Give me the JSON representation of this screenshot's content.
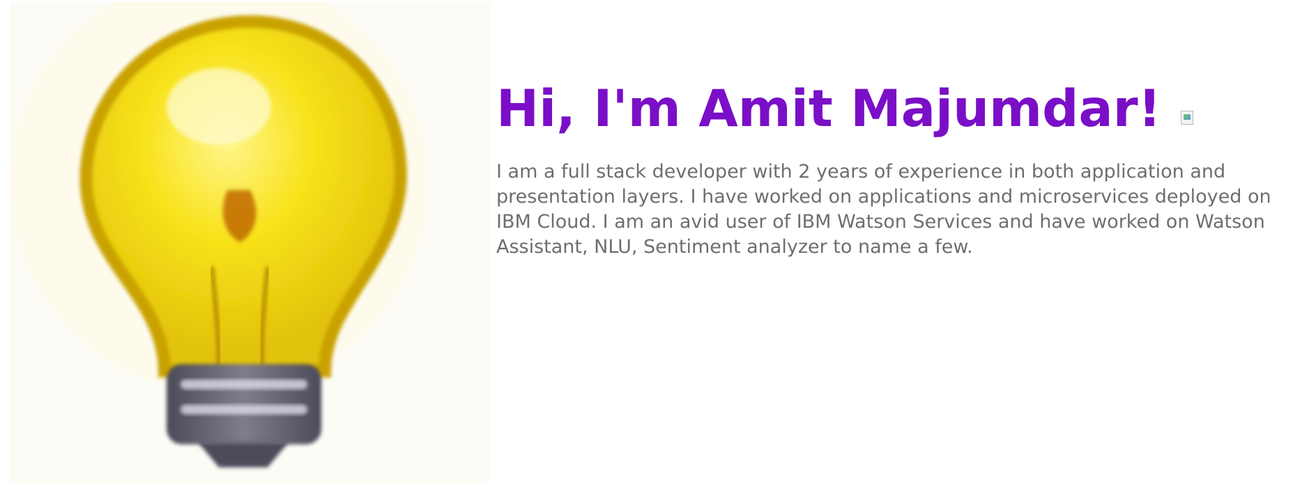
{
  "profile": {
    "name_heading": "Hi, I'm Amit Majumdar!",
    "bio": "I am a full stack developer with 2 years of experience in both application and presentation layers. I have worked on applications and microservices deployed on IBM Cloud. I am an avid user of IBM Watson Services and have worked on Watson Assistant, NLU, Sentiment analyzer to name a few.",
    "hero_image_icon": "lightbulb-icon",
    "heading_image_icon": "broken-image-icon"
  },
  "colors": {
    "accent": "#7a0fc7",
    "body_text": "#6e6e6e",
    "background": "#ffffff"
  }
}
